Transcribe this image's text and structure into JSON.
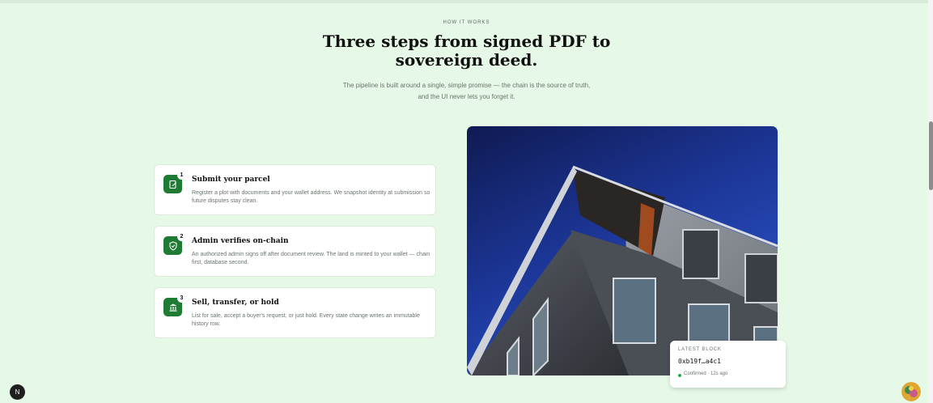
{
  "section": {
    "eyebrow": "HOW IT WORKS",
    "headline_line1": "Three steps from signed PDF to",
    "headline_line2": "sovereign deed.",
    "sub_line1": "The pipeline is built around a single, simple promise — the chain is the source of truth,",
    "sub_line2": "and the UI never lets you forget it."
  },
  "steps": [
    {
      "num": "1",
      "icon": "edit-document-icon",
      "title": "Submit your parcel",
      "desc": "Register a plot with documents and your wallet address. We snapshot identity at submission so future disputes stay clean."
    },
    {
      "num": "2",
      "icon": "shield-check-icon",
      "title": "Admin verifies on-chain",
      "desc": "An authorized admin signs off after document review. The land is minted to your wallet — chain first, database second."
    },
    {
      "num": "3",
      "icon": "bank-icon",
      "title": "Sell, transfer, or hold",
      "desc": "List for sale, accept a buyer's request, or just hold. Every state change writes an immutable history row."
    }
  ],
  "latest_block": {
    "label": "LATEST BLOCK",
    "hash": "0xb19f…a4c1",
    "status": "Confirmed · 12s ago",
    "status_color": "#22b04b"
  },
  "floating": {
    "next_badge": "N"
  },
  "colors": {
    "accent": "#1f7a34",
    "background": "#e6f8e6"
  }
}
